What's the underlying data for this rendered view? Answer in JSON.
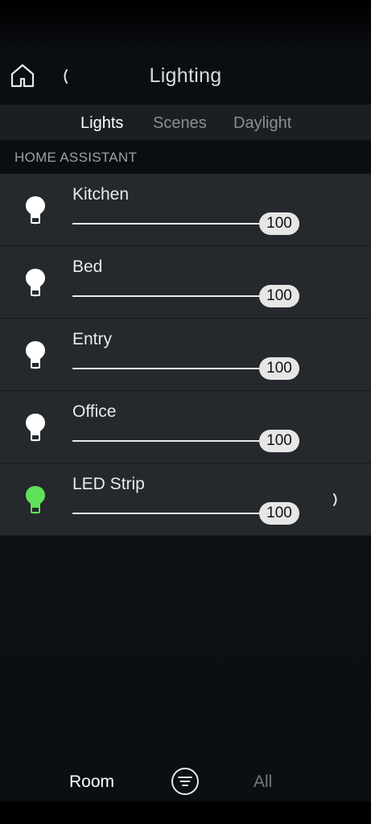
{
  "header": {
    "title": "Lighting"
  },
  "tabs": [
    {
      "label": "Lights",
      "active": true
    },
    {
      "label": "Scenes",
      "active": false
    },
    {
      "label": "Daylight",
      "active": false
    }
  ],
  "section": {
    "label": "HOME ASSISTANT"
  },
  "lights": [
    {
      "name": "Kitchen",
      "level": 100,
      "on_color": "#ffffff",
      "has_detail": false
    },
    {
      "name": "Bed",
      "level": 100,
      "on_color": "#ffffff",
      "has_detail": false
    },
    {
      "name": "Entry",
      "level": 100,
      "on_color": "#ffffff",
      "has_detail": false
    },
    {
      "name": "Office",
      "level": 100,
      "on_color": "#ffffff",
      "has_detail": false
    },
    {
      "name": "LED Strip",
      "level": 100,
      "on_color": "#5fe15a",
      "has_detail": true
    }
  ],
  "bottom_nav": {
    "room_label": "Room",
    "all_label": "All"
  },
  "colors": {
    "accent_green": "#5fe15a",
    "row_bg": "#25282c",
    "tab_bar_bg": "#1b1e22"
  }
}
